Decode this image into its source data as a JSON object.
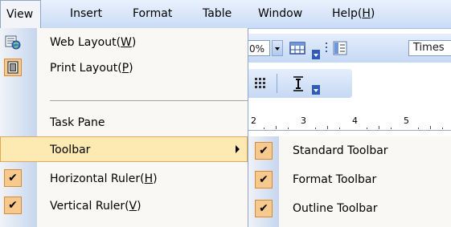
{
  "menubar": {
    "items": [
      "View",
      "Insert",
      "Format",
      "Table",
      "Window",
      "Help(",
      "H",
      ")"
    ]
  },
  "view_menu": {
    "web_layout": {
      "pre": "Web Layout(",
      "key": "W",
      "post": ")"
    },
    "print_layout": {
      "pre": "Print Layout(",
      "key": "P",
      "post": ")"
    },
    "task_pane": "Task Pane",
    "toolbar": "Toolbar",
    "horizontal_ruler": {
      "pre": "Horizontal Ruler(",
      "key": "H",
      "post": ")"
    },
    "vertical_ruler": {
      "pre": "Vertical Ruler(",
      "key": "V",
      "post": ")"
    }
  },
  "toolbar_submenu": {
    "items": [
      "Standard Toolbar",
      "Format Toolbar",
      "Outline Toolbar"
    ]
  },
  "toolbar_bg": {
    "zoom_value": "0%",
    "font_name": "Times"
  },
  "ruler": {
    "numbers": [
      "2",
      "3",
      "4",
      "5"
    ]
  },
  "colors": {
    "menubar_gradient_top": "#e9f1fd",
    "menubar_gradient_bottom": "#c9dcf6",
    "highlight_fill": "#fdeab3",
    "highlight_border": "#e1a75e",
    "check_fill": "#f7c98c",
    "check_border": "#d48a36",
    "menu_bg": "#f9f8f4"
  },
  "checks": {
    "horizontal_ruler": true,
    "vertical_ruler": true,
    "standard_toolbar": true,
    "format_toolbar": true,
    "outline_toolbar": true
  },
  "check_glyph": "✔"
}
